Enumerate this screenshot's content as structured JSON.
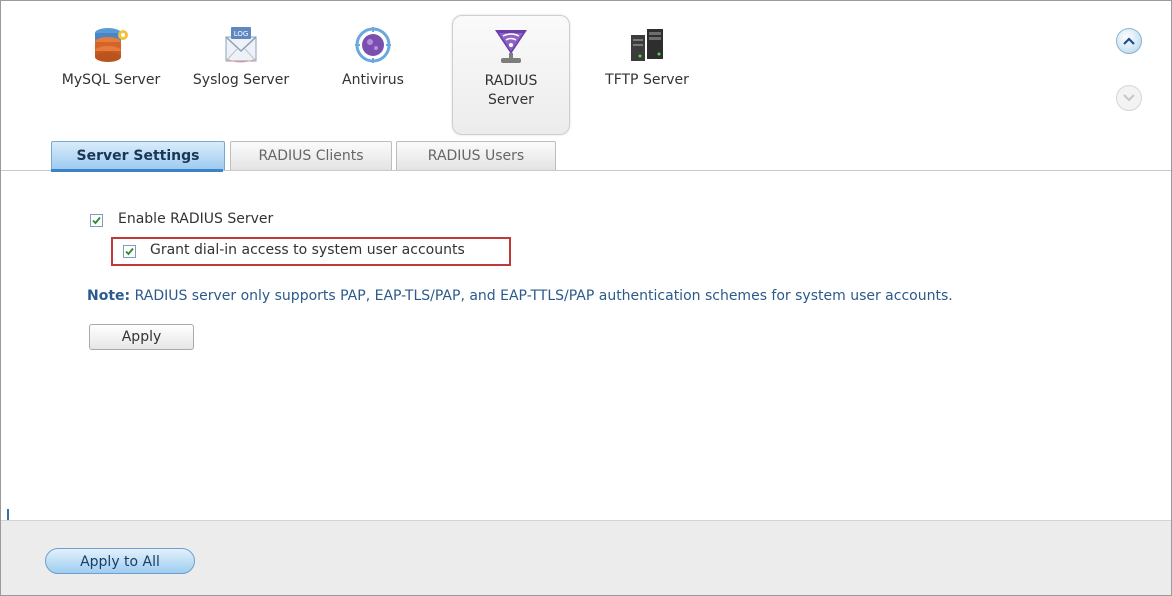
{
  "apps": [
    {
      "label": "MySQL Server",
      "icon": "mysql-server-icon"
    },
    {
      "label": "Syslog Server",
      "icon": "syslog-server-icon",
      "icon_text": "LOG"
    },
    {
      "label": "Antivirus",
      "icon": "antivirus-icon"
    },
    {
      "label": "RADIUS Server",
      "icon": "radius-server-icon",
      "active": true
    },
    {
      "label": "TFTP Server",
      "icon": "tftp-server-icon"
    }
  ],
  "scroll": {
    "up_icon": "chevron-up-icon",
    "down_icon": "chevron-down-icon"
  },
  "tabs": [
    {
      "label": "Server Settings",
      "active": true
    },
    {
      "label": "RADIUS Clients"
    },
    {
      "label": "RADIUS Users"
    }
  ],
  "settings": {
    "enable_label": "Enable RADIUS Server",
    "enable_checked": true,
    "grant_label": "Grant dial-in access to system user accounts",
    "grant_checked": true,
    "note_prefix": "Note:",
    "note_text": " RADIUS server only supports PAP, EAP-TLS/PAP, and EAP-TTLS/PAP authentication schemes for system user accounts.",
    "apply_label": "Apply"
  },
  "footer": {
    "apply_all_label": "Apply to All"
  },
  "colors": {
    "accent": "#3b83c7",
    "highlight": "#c0393b",
    "note": "#2c5a8a"
  }
}
